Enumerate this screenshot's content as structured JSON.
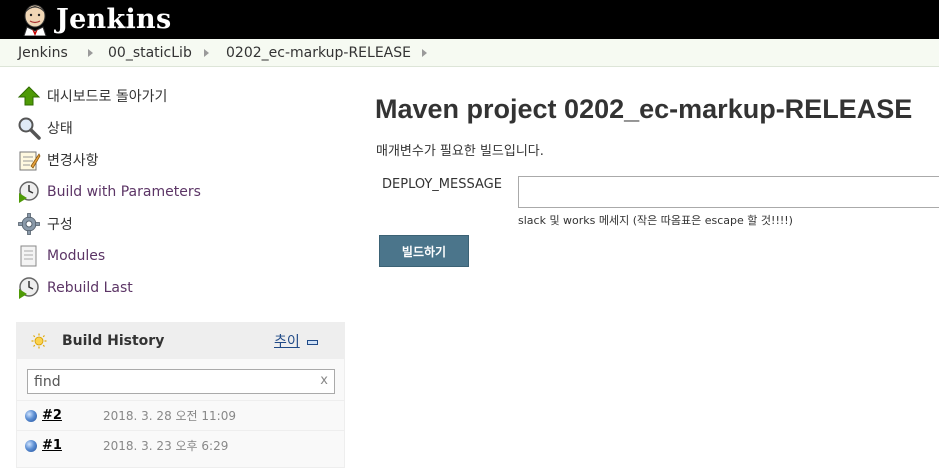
{
  "header": {
    "logo_text": "Jenkins"
  },
  "breadcrumb": [
    "Jenkins",
    "00_staticLib",
    "0202_ec-markup-RELEASE"
  ],
  "sidebar": {
    "items": [
      {
        "label": "대시보드로 돌아가기",
        "icon": "up-arrow-icon"
      },
      {
        "label": "상태",
        "icon": "magnifier-icon"
      },
      {
        "label": "변경사항",
        "icon": "notepad-icon"
      },
      {
        "label": "Build with Parameters",
        "icon": "clock-play-icon"
      },
      {
        "label": "구성",
        "icon": "gear-icon"
      },
      {
        "label": "Modules",
        "icon": "document-icon"
      },
      {
        "label": "Rebuild Last",
        "icon": "clock-play-icon"
      }
    ]
  },
  "build_history": {
    "title": "Build History",
    "trend": "추이",
    "search_placeholder": "find",
    "clear": "x",
    "builds": [
      {
        "number": "#2",
        "date": "2018. 3. 28 오전 11:09",
        "status_color": "#4a7fcc"
      },
      {
        "number": "#1",
        "date": "2018. 3. 23 오후 6:29",
        "status_color": "#4a7fcc"
      }
    ]
  },
  "main": {
    "title": "Maven project 0202_ec-markup-RELEASE",
    "description": "매개변수가 필요한 빌드입니다.",
    "param_label": "DEPLOY_MESSAGE",
    "param_value": "",
    "param_hint": "slack 및 works 메세지 (작은 따옴표은 escape 할 것!!!!)",
    "build_button": "빌드하기"
  },
  "colors": {
    "header_bg": "#000000",
    "breadcrumb_bg": "#f6faf2",
    "button_bg": "#4b758b",
    "link_purple": "#5c3566"
  }
}
